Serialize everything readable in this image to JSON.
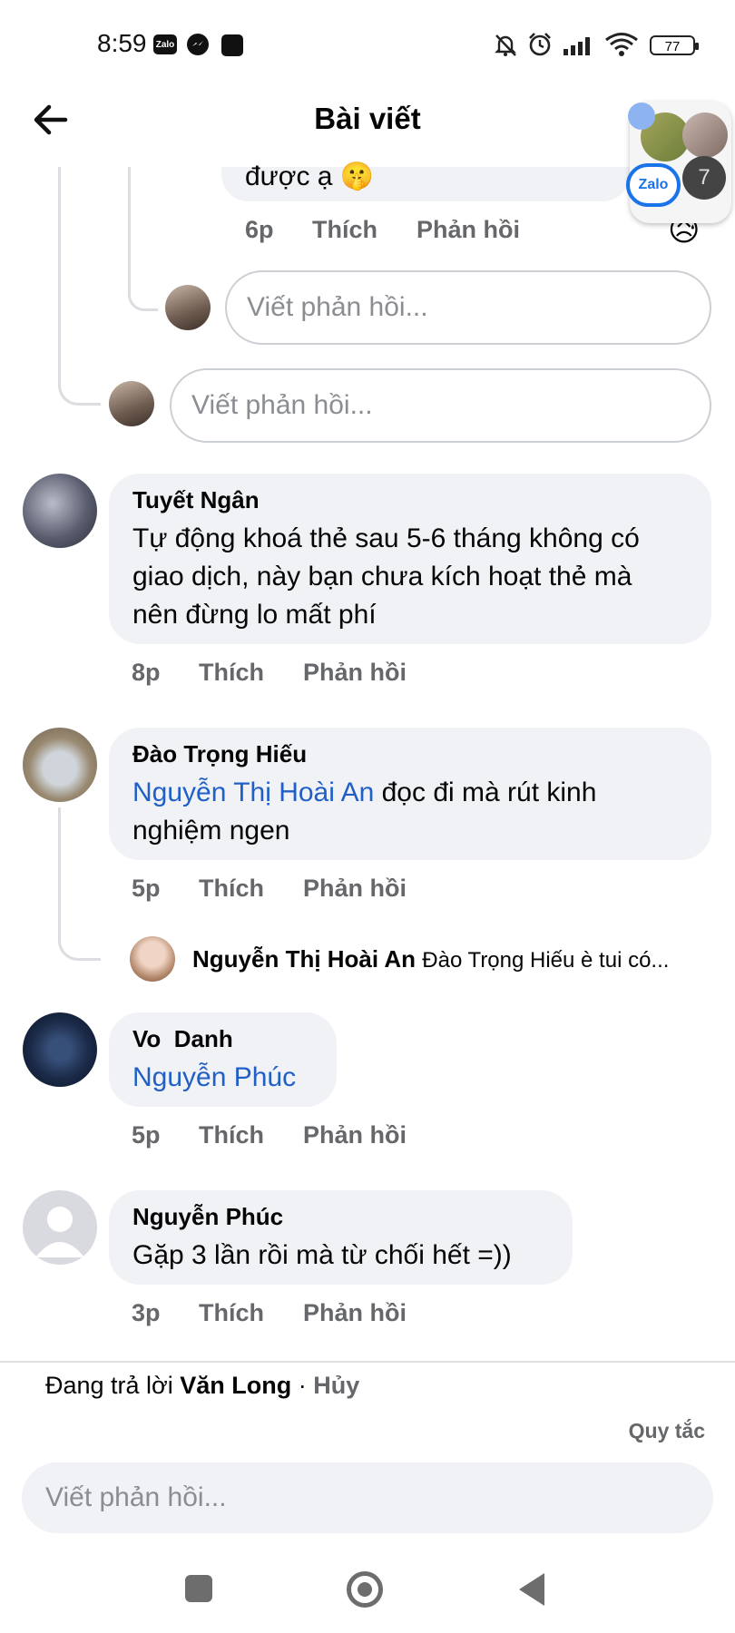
{
  "status_bar": {
    "time": "8:59",
    "zalo_label": "Zalo",
    "battery": "77"
  },
  "header": {
    "title": "Bài viết"
  },
  "floating_chat": {
    "app_label": "Zalo",
    "unread_count": "7"
  },
  "thread_top": {
    "partial_text": "được ạ 🤫",
    "time": "6p",
    "like": "Thích",
    "reply": "Phản hồi",
    "reply_placeholder_nested": "Viết phản hồi...",
    "reply_placeholder": "Viết phản hồi..."
  },
  "comments": [
    {
      "author": "Tuyết Ngân",
      "text_lines": [
        "Tự động khoá thẻ sau 5-6 tháng không có",
        "giao dịch, này bạn chưa kích hoạt thẻ mà",
        "nên đừng lo mất phí"
      ],
      "time": "8p",
      "like": "Thích",
      "reply": "Phản hồi"
    },
    {
      "author": "Đào Trọng Hiếu",
      "mention": "Nguyễn Thị Hoài An",
      "text_after_mention": " đọc đi mà rút kinh",
      "text_line2": "nghiệm ngen",
      "time": "5p",
      "like": "Thích",
      "reply": "Phản hồi",
      "reply_preview": {
        "author": "Nguyễn Thị Hoài An",
        "snippet": "Đào Trọng Hiếu è tui có..."
      }
    },
    {
      "author": "Vo  Danh",
      "mention": "Nguyễn Phúc",
      "time": "5p",
      "like": "Thích",
      "reply": "Phản hồi"
    },
    {
      "author": "Nguyễn Phúc",
      "text": "Gặp 3 lần rồi mà từ chối hết =))",
      "time": "3p",
      "like": "Thích",
      "reply": "Phản hồi"
    }
  ],
  "footer": {
    "replying_prefix": "Đang trả lời ",
    "replying_to": "Văn Long",
    "separator": " · ",
    "cancel": "Hủy",
    "rules": "Quy tắc",
    "input_placeholder": "Viết phản hồi..."
  },
  "colors": {
    "bubble_bg": "#f0f2f5",
    "link": "#1f5fc7",
    "meta": "#65676b"
  }
}
